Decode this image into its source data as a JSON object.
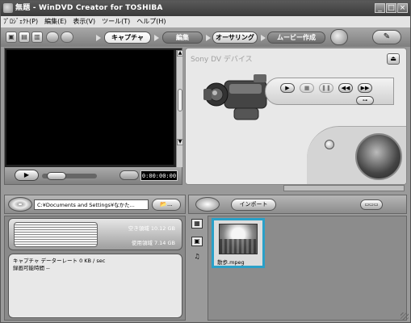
{
  "window": {
    "title": "無題 - WinDVD Creator for TOSHIBA",
    "minimize_label": "_",
    "maximize_label": "□",
    "close_label": "×"
  },
  "menu": {
    "items": [
      {
        "label": "ﾌﾟﾛｼﾞｪｸﾄ(P)"
      },
      {
        "label": "編集(E)"
      },
      {
        "label": "表示(V)"
      },
      {
        "label": "ツール(T)"
      },
      {
        "label": "ヘルプ(H)"
      }
    ]
  },
  "toolbar": {
    "tabs": [
      {
        "label": "キャプチャ",
        "active": true
      },
      {
        "label": "編集",
        "active": false
      },
      {
        "label": "オーサリング",
        "active": false
      },
      {
        "label": "ムービー作成",
        "active": false
      }
    ]
  },
  "preview": {
    "play_icon": "▶",
    "timecode": "0:00:00:00"
  },
  "device": {
    "title": "Sony DV デバイス",
    "eject_icon": "⏏",
    "controls": [
      "▶",
      "■",
      "❚❚",
      "◀◀",
      "▶▶"
    ],
    "extra_control": "⊶"
  },
  "source": {
    "path": "C:¥Documents and Settings¥なかた...",
    "browse_label": "📂..."
  },
  "disk": {
    "free_space": "空き領域 10.12 GB",
    "used_space": "使用領域 7.14 GB"
  },
  "status": {
    "capture_rate": "キャプチャ データーレート 0 KB / sec",
    "recordable_time": "録画可能時間 --"
  },
  "media": {
    "import_label": "インポート",
    "view_label": "▭▭▭",
    "type_icons": [
      "▦",
      "▣",
      "♫"
    ],
    "items": [
      {
        "filename": "散歩.mpeg"
      }
    ]
  },
  "accent": "#2aa0c8"
}
